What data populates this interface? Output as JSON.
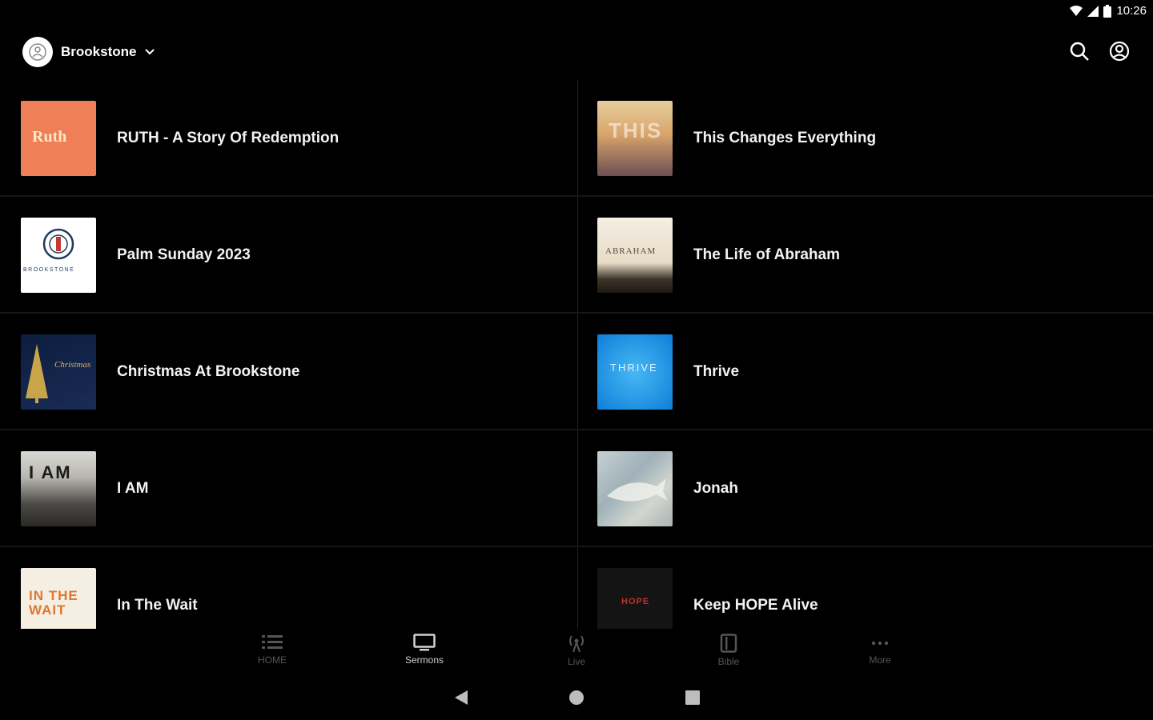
{
  "status": {
    "time": "10:26"
  },
  "header": {
    "account_name": "Brookstone",
    "icons": [
      "search-icon",
      "account-circle-icon"
    ]
  },
  "series": [
    {
      "title": "RUTH - A Story Of Redemption",
      "thumb_text": "Ruth"
    },
    {
      "title": "This Changes Everything",
      "thumb_text": "THIS"
    },
    {
      "title": "Palm Sunday 2023",
      "thumb_text": "BROOKSTONE"
    },
    {
      "title": "The Life of Abraham",
      "thumb_text": "ABRAHAM"
    },
    {
      "title": "Christmas At Brookstone",
      "thumb_text": "Christmas"
    },
    {
      "title": "Thrive",
      "thumb_text": "THRIVE"
    },
    {
      "title": "I AM",
      "thumb_text": "I AM"
    },
    {
      "title": "Jonah",
      "thumb_text": ""
    },
    {
      "title": "In The Wait",
      "thumb_text": "IN THE WAIT"
    },
    {
      "title": "Keep HOPE Alive",
      "thumb_text": "HOPE"
    }
  ],
  "bottom_nav": {
    "items": [
      {
        "label": "HOME",
        "icon": "list-icon"
      },
      {
        "label": "Sermons",
        "icon": "tv-icon",
        "active": true
      },
      {
        "label": "Live",
        "icon": "broadcast-icon"
      },
      {
        "label": "Bible",
        "icon": "book-icon"
      },
      {
        "label": "More",
        "icon": "more-dots-icon"
      }
    ]
  },
  "colors": {
    "background": "#000000",
    "active_nav": "#cfcfcf",
    "inactive_nav": "#555555"
  }
}
